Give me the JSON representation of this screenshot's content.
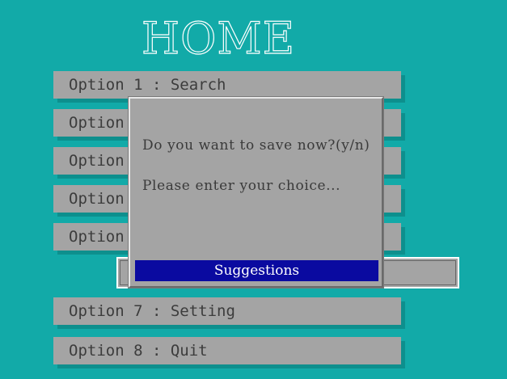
{
  "header": {
    "title": "HOME"
  },
  "menu": {
    "items": [
      {
        "label": "Option 1 : Search"
      },
      {
        "label": "Option"
      },
      {
        "label": "Option"
      },
      {
        "label": "Option"
      },
      {
        "label": "Option"
      },
      {
        "label": "Option 7 : Setting"
      },
      {
        "label": "Option 8 : Quit"
      }
    ]
  },
  "dialog": {
    "question": "Do you want to save now?(y/n)",
    "prompt": "Please enter your choice...",
    "suggestions_label": "Suggestions"
  },
  "colors": {
    "background": "#12aaa8",
    "menu_item": "#a4a4a4",
    "suggestions_bar": "#0a0aa0"
  }
}
